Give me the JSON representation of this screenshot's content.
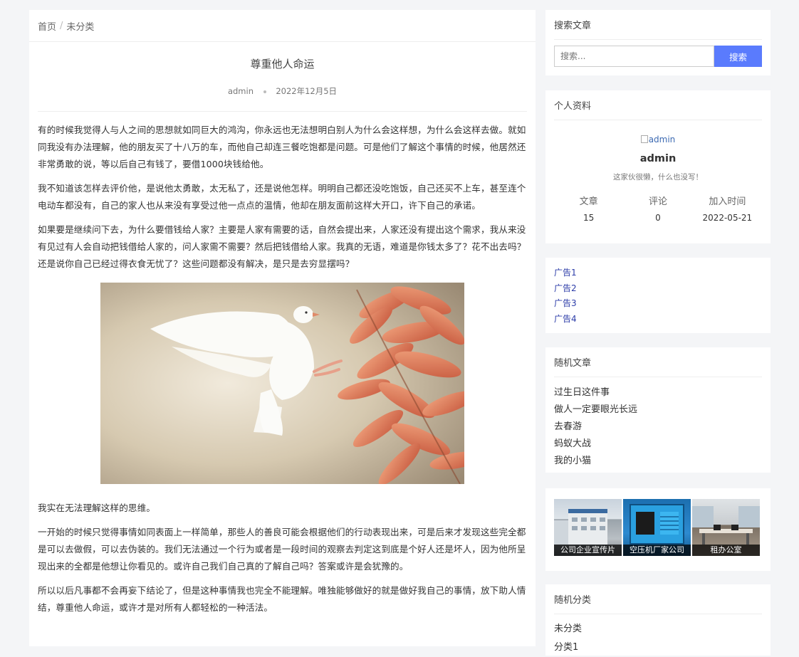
{
  "breadcrumb": {
    "home": "首页",
    "separator": "/",
    "category": "未分类"
  },
  "article": {
    "title": "尊重他人命运",
    "author": "admin",
    "date": "2022年12月5日",
    "paragraphs_before_image": [
      "有的时候我觉得人与人之间的思想就如同巨大的鸿沟，你永远也无法想明白别人为什么会这样想，为什么会这样去做。就如同我没有办法理解，他的朋友买了十八万的车，而他自己却连三餐吃饱都是问题。可是他们了解这个事情的时候，他居然还非常勇敢的说，等以后自己有钱了，要借1000块钱给他。",
      "我不知道该怎样去评价他，是说他太勇敢，太无私了，还是说他怎样。明明自己都还没吃饱饭，自己还买不上车，甚至连个电动车都没有，自己的家人也从来没有享受过他一点点的温情，他却在朋友面前这样大开口，许下自己的承诺。",
      "如果要是继续问下去，为什么要借钱给人家？主要是人家有需要的话，自然会提出来，人家还没有提出这个需求，我从来没有见过有人会自动把钱借给人家的，问人家需不需要？然后把钱借给人家。我真的无语，难道是你钱太多了？花不出去吗？还是说你自己已经过得衣食无忧了？这些问题都没有解决，是只是去穷显摆吗？"
    ],
    "paragraphs_after_image": [
      "我实在无法理解这样的思维。",
      "一开始的时候只觉得事情如同表面上一样简单，那些人的善良可能会根据他们的行动表现出来，可是后来才发现这些完全都是可以去做假，可以去伪装的。我们无法通过一个行为或者是一段时间的观察去判定这到底是个好人还是坏人，因为他所呈现出来的全都是他想让你看见的。或许自己我们自己真的了解自己吗？答案或许是会犹豫的。",
      "所以以后凡事都不会再妄下结论了，但是这种事情我也完全不能理解。唯独能够做好的就是做好我自己的事情，放下助人情结，尊重他人命运，或许才是对所有人都轻松的一种活法。"
    ]
  },
  "search": {
    "title": "搜索文章",
    "placeholder": "搜索...",
    "button": "搜索"
  },
  "profile": {
    "title": "个人资料",
    "avatar_alt": "admin",
    "name": "admin",
    "bio": "这家伙很懒，什么也没写！",
    "stats": [
      {
        "label": "文章",
        "value": "15"
      },
      {
        "label": "评论",
        "value": "0"
      },
      {
        "label": "加入时间",
        "value": "2022-05-21"
      }
    ]
  },
  "ads": [
    "广告1",
    "广告2",
    "广告3",
    "广告4"
  ],
  "random_posts": {
    "title": "随机文章",
    "items": [
      "过生日这件事",
      "做人一定要眼光长远",
      "去春游",
      "蚂蚁大战",
      "我的小猫"
    ]
  },
  "gallery": [
    "公司企业宣传片",
    "空压机厂家公司",
    "租办公室"
  ],
  "random_categories": {
    "title": "随机分类",
    "items": [
      "未分类",
      "分类1"
    ]
  },
  "colors": {
    "accent": "#5a7bfd",
    "link": "#2c3ca8",
    "background": "#f4f5f7"
  }
}
